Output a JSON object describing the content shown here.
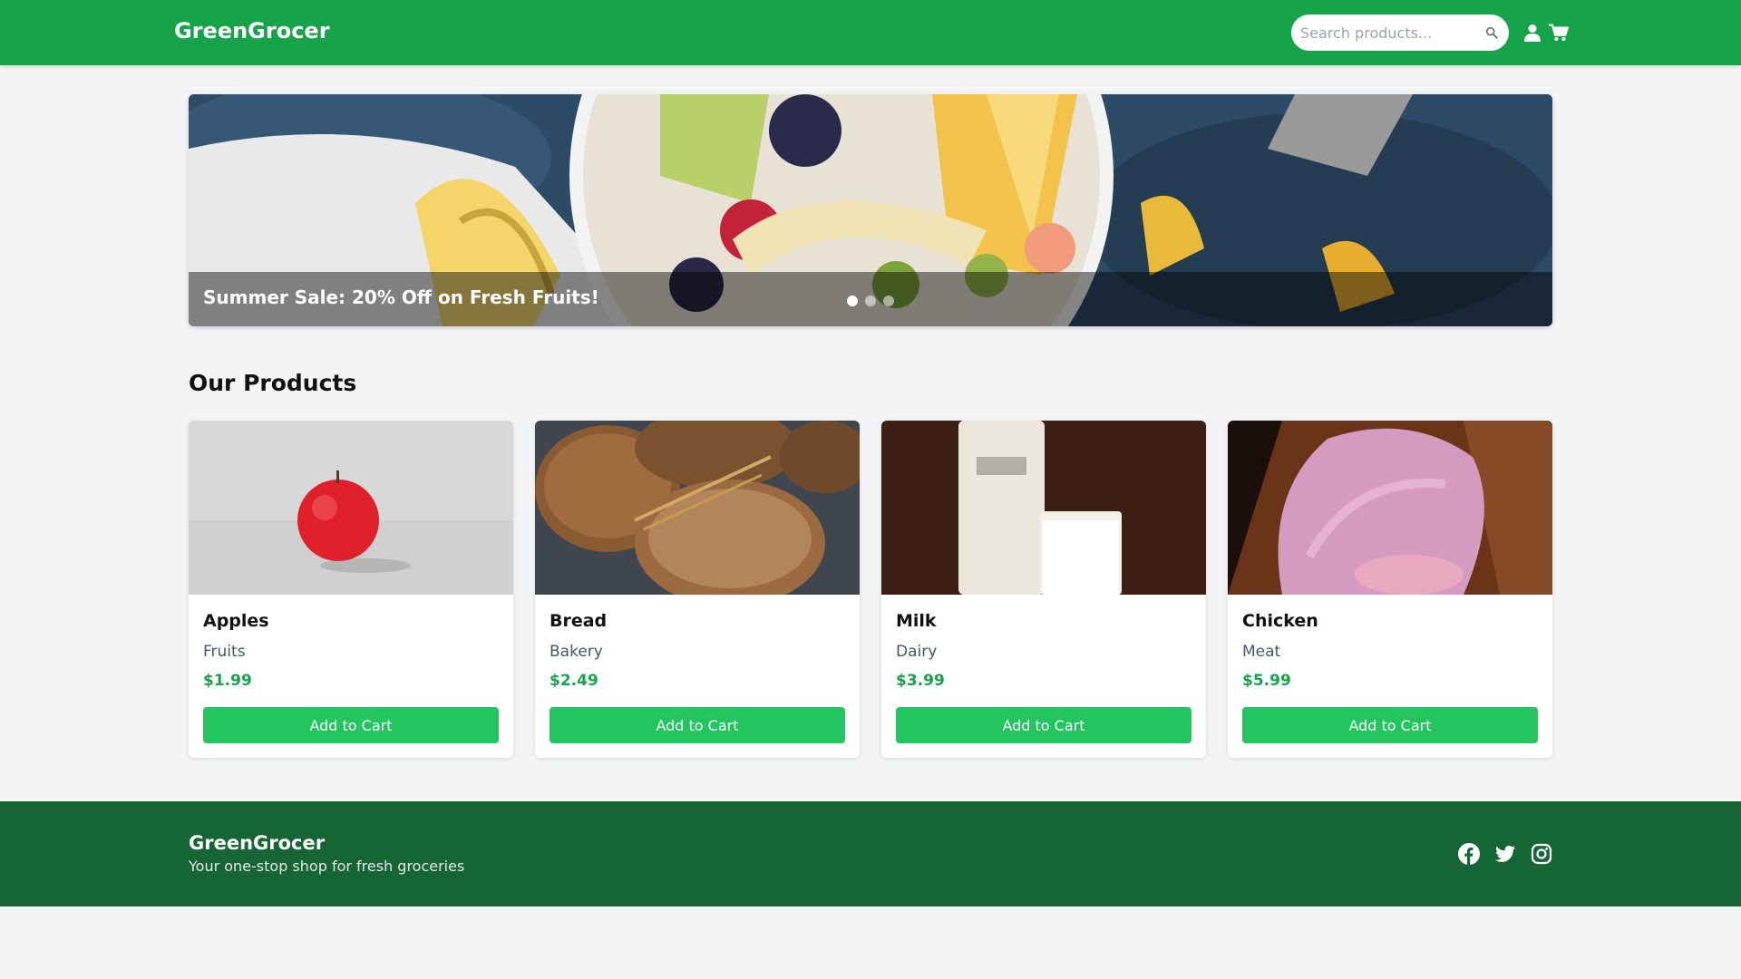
{
  "header": {
    "brand": "GreenGrocer",
    "search_placeholder": "Search products...",
    "icons": [
      "search-icon",
      "user-icon",
      "cart-icon"
    ]
  },
  "banner": {
    "text": "Summer Sale: 20% Off on Fresh Fruits!",
    "slide_count": 3,
    "active_slide": 1
  },
  "products": {
    "title": "Our Products",
    "items": [
      {
        "name": "Apples",
        "category": "Fruits",
        "price": "$1.99",
        "button": "Add to Cart"
      },
      {
        "name": "Bread",
        "category": "Bakery",
        "price": "$2.49",
        "button": "Add to Cart"
      },
      {
        "name": "Milk",
        "category": "Dairy",
        "price": "$3.99",
        "button": "Add to Cart"
      },
      {
        "name": "Chicken",
        "category": "Meat",
        "price": "$5.99",
        "button": "Add to Cart"
      }
    ]
  },
  "footer": {
    "brand": "GreenGrocer",
    "tagline": "Your one-stop shop for fresh groceries",
    "social": [
      "facebook-icon",
      "twitter-icon",
      "instagram-icon"
    ]
  },
  "colors": {
    "primary": "#16a34a",
    "button": "#22c55e",
    "footer": "#166534",
    "background": "#f3f4f6"
  }
}
